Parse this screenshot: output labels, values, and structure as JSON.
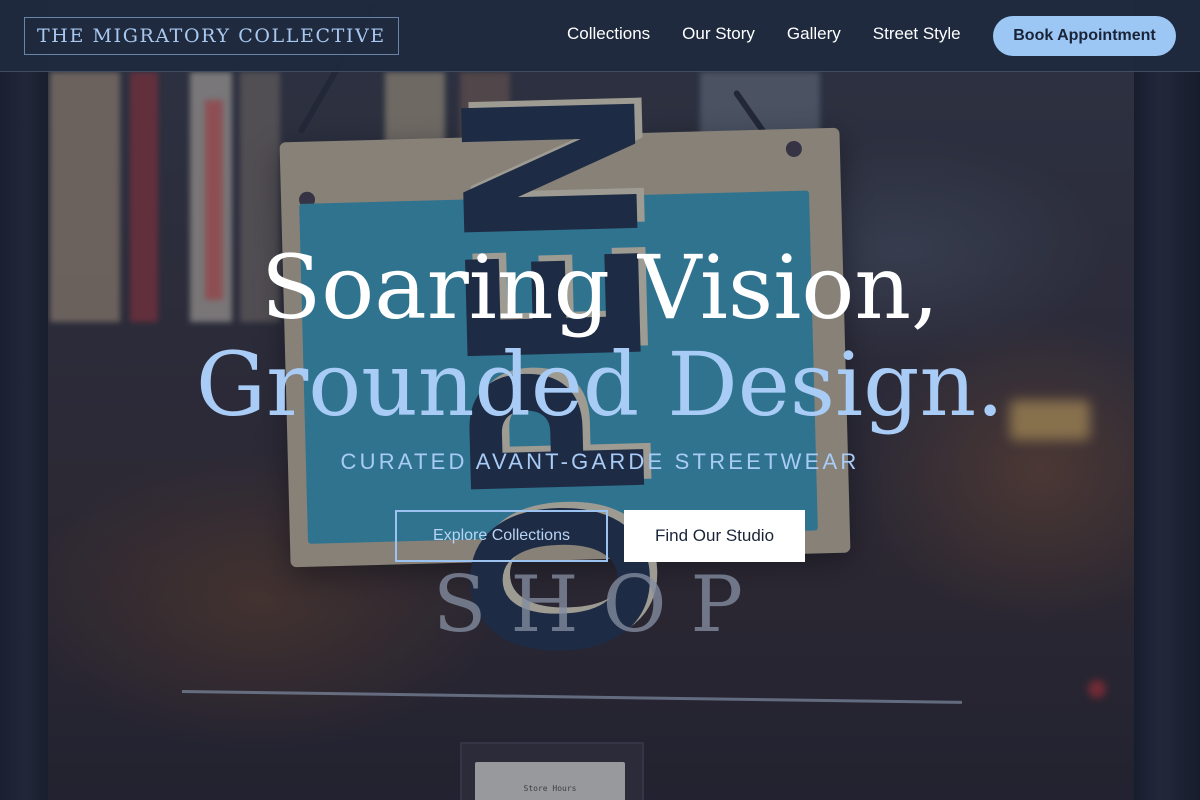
{
  "header": {
    "brand": "THE MIGRATORY COLLECTIVE",
    "nav": [
      {
        "label": "Collections"
      },
      {
        "label": "Our Story"
      },
      {
        "label": "Gallery"
      },
      {
        "label": "Street Style"
      }
    ],
    "cta_label": "Book Appointment"
  },
  "hero": {
    "title_line1": "Soaring Vision,",
    "title_line2": "Grounded Design.",
    "subtitle": "CURATED AVANT-GARDE STREETWEAR",
    "primary_button": "Explore Collections",
    "secondary_button": "Find Our Studio"
  },
  "background": {
    "sign_text": "OPEN",
    "glass_text": "SHOP",
    "card_text": "Store Hours"
  },
  "colors": {
    "accent": "#9cc7f5",
    "header_bg": "#1f2a3e",
    "hero_accent_text": "#a9ccf6"
  }
}
